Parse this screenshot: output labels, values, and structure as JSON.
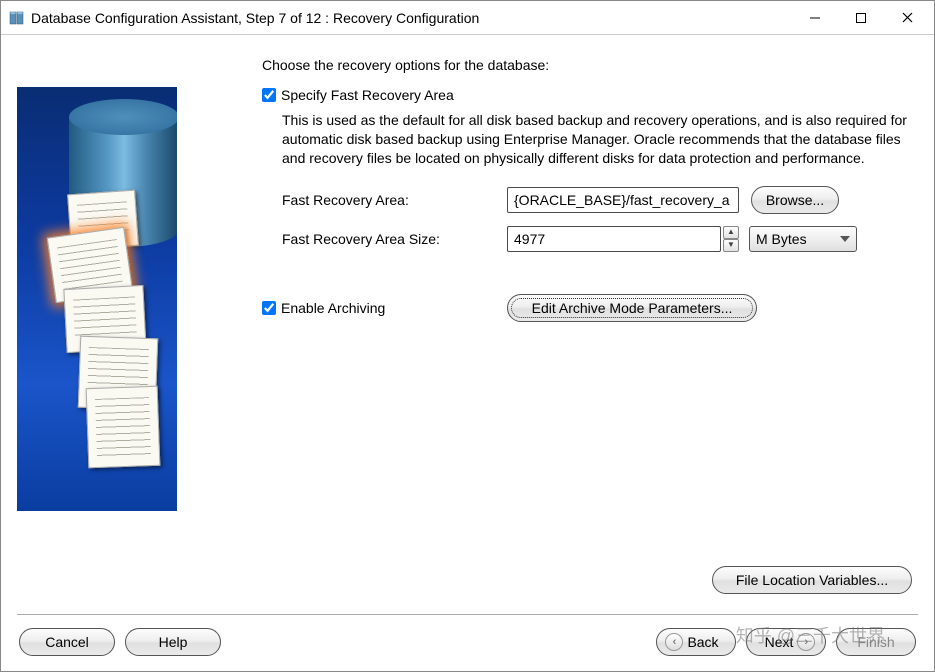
{
  "window": {
    "title": "Database Configuration Assistant, Step 7 of 12 : Recovery Configuration"
  },
  "main": {
    "heading": "Choose the recovery options for the database:",
    "specify_fra_label": "Specify Fast Recovery Area",
    "fra_description": "This is used as the default for all disk based backup and recovery operations, and is also required for automatic disk based backup using Enterprise Manager. Oracle recommends that the database files and recovery files be located on physically different disks for data protection and performance.",
    "fra_path_label": "Fast Recovery Area:",
    "fra_path_value": "{ORACLE_BASE}/fast_recovery_a",
    "browse_label": "Browse...",
    "fra_size_label": "Fast Recovery Area Size:",
    "fra_size_value": "4977",
    "fra_size_unit": "M Bytes",
    "enable_archiving_label": "Enable Archiving",
    "edit_archive_label": "Edit Archive Mode Parameters...",
    "file_location_vars_label": "File Location Variables..."
  },
  "footer": {
    "cancel": "Cancel",
    "help": "Help",
    "back": "Back",
    "next": "Next",
    "finish": "Finish"
  },
  "watermark": "知乎 @三千大世界"
}
